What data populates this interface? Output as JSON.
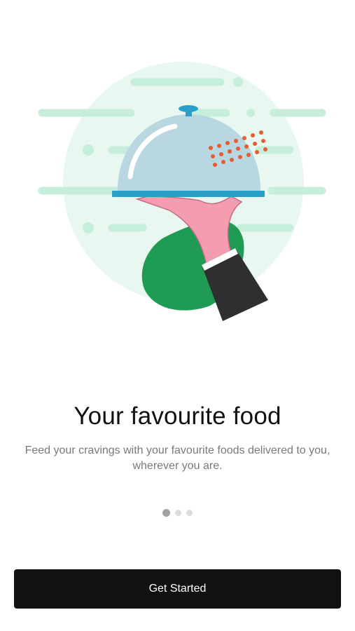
{
  "onboarding": {
    "illustration_icon": "food-cloche-served-icon",
    "title": "Your favourite food",
    "subtitle": "Feed your cravings with your favourite foods delivered to you, wherever you are.",
    "pagination": {
      "total": 3,
      "current": 1
    },
    "cta_label": "Get Started"
  },
  "colors": {
    "background": "#ffffff",
    "accent_button": "#111111",
    "illustration_circle": "#e8f8f0",
    "cloche": "#b8d7e1",
    "tray": "#2a9fc9",
    "sleeve": "#1f9b54",
    "hand": "#f49db1",
    "dots": "#e85d2e"
  }
}
